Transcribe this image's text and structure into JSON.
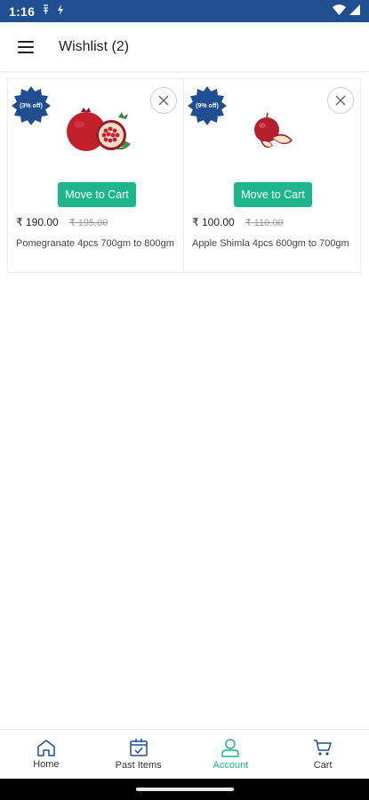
{
  "status_bar": {
    "time": "1:16",
    "bg_color": "#1f4e91",
    "icons": [
      "notification-icon",
      "download-icon",
      "wifi-icon",
      "signal-icon"
    ]
  },
  "header": {
    "title": "Wishlist (2)",
    "menu_icon": "hamburger-menu-icon"
  },
  "wishlist": {
    "items": [
      {
        "badge": "(3% off)",
        "image": "pomegranate",
        "button_label": "Move to Cart",
        "price": "₹ 190.00",
        "mrp": "₹ 195.00",
        "name": "Pomegranate 4pcs 700gm to 800gm"
      },
      {
        "badge": "(9% off)",
        "image": "apple",
        "button_label": "Move to Cart",
        "price": "₹ 100.00",
        "mrp": "₹ 110.00",
        "name": "Apple Shimla 4pcs 600gm to 700gm"
      }
    ]
  },
  "bottom_nav": {
    "active": "Account",
    "items": [
      {
        "label": "Home",
        "icon": "home-icon"
      },
      {
        "label": "Past Items",
        "icon": "past-items-icon"
      },
      {
        "label": "Account",
        "icon": "account-icon"
      },
      {
        "label": "Cart",
        "icon": "cart-icon"
      }
    ]
  },
  "colors": {
    "primary": "#1f4e91",
    "accent": "#1db68a",
    "strike_price": "#9a9a9a"
  }
}
